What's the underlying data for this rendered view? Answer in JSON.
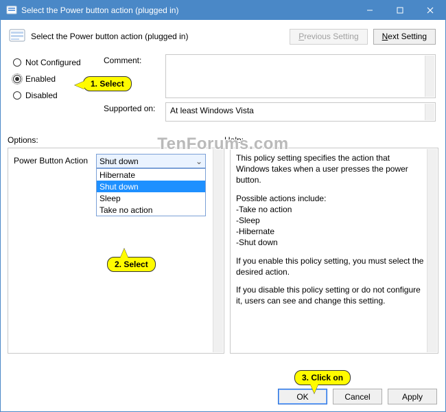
{
  "titlebar": {
    "title": "Select the Power button action (plugged in)"
  },
  "header": {
    "text": "Select the Power button action (plugged in)"
  },
  "nav": {
    "prev": "Previous Setting",
    "next": "Next Setting"
  },
  "radios": {
    "not_configured": "Not Configured",
    "enabled": "Enabled",
    "disabled": "Disabled"
  },
  "meta": {
    "comment_label": "Comment:",
    "supported_label": "Supported on:",
    "supported_value": "At least Windows Vista"
  },
  "sections": {
    "options": "Options:",
    "help": "Help:"
  },
  "option": {
    "label": "Power Button Action",
    "selected": "Shut down",
    "items": [
      "Hibernate",
      "Shut down",
      "Sleep",
      "Take no action"
    ]
  },
  "help": {
    "p1": "This policy setting specifies the action that Windows takes when a user presses the power button.",
    "p2": "Possible actions include:",
    "a1": "-Take no action",
    "a2": "-Sleep",
    "a3": "-Hibernate",
    "a4": "-Shut down",
    "p3": "If you enable this policy setting, you must select the desired action.",
    "p4": "If you disable this policy setting or do not configure it, users can see and change this setting."
  },
  "buttons": {
    "ok": "OK",
    "cancel": "Cancel",
    "apply": "Apply"
  },
  "callouts": {
    "c1": "1. Select",
    "c2": "2. Select",
    "c3": "3. Click on"
  },
  "watermark": "TenForums.com"
}
